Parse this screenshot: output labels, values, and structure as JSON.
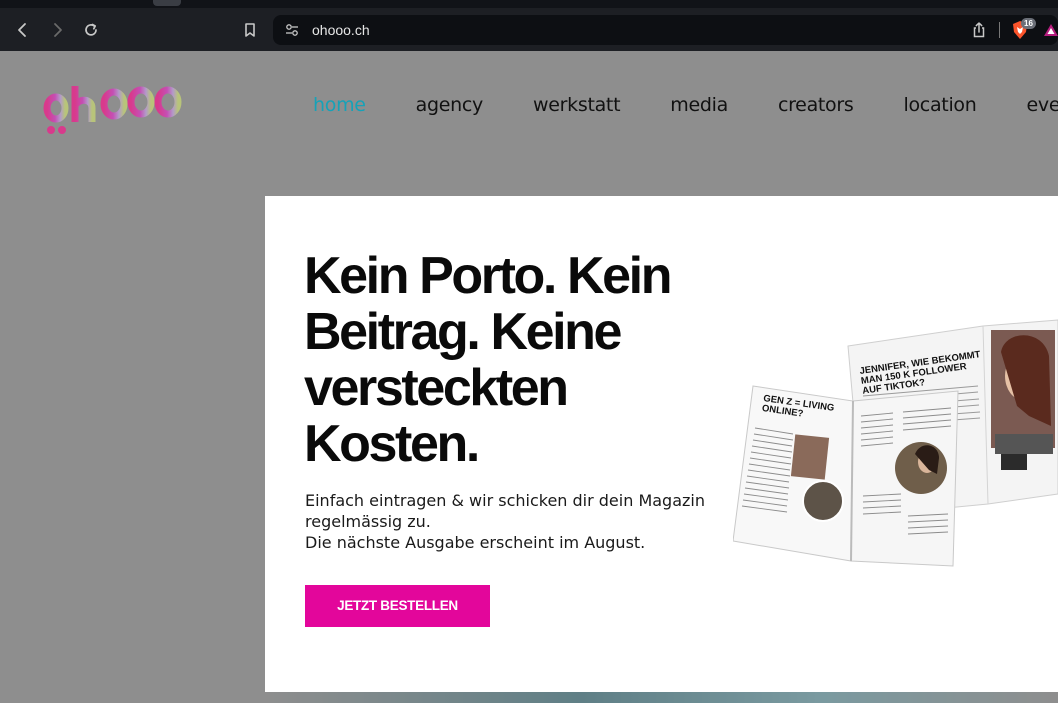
{
  "browser": {
    "url": "ohooo.ch",
    "shield_badge": "16"
  },
  "site": {
    "logo_text": "ohooo",
    "nav": [
      {
        "label": "home",
        "active": true
      },
      {
        "label": "agency"
      },
      {
        "label": "werkstatt"
      },
      {
        "label": "media"
      },
      {
        "label": "creators"
      },
      {
        "label": "location"
      },
      {
        "label": "event"
      }
    ]
  },
  "modal": {
    "headline": "Kein Porto. Kein Beitrag. Keine versteckten Kosten.",
    "body_line1": "Einfach eintragen & wir schicken dir dein Magazin regelmässig zu.",
    "body_line2": "Die nächste Ausgabe erscheint im August.",
    "cta_label": "JETZT BESTELLEN",
    "magazine_left_title": "GEN Z = LIVING ONLINE?",
    "magazine_right_title": "JENNIFER, WIE BEKOMMT MAN 150 K FOLLOWER AUF TIKTOK?"
  },
  "colors": {
    "accent_nav": "#16a2b8",
    "cta": "#e3069b",
    "chrome": "#1d1f24"
  }
}
